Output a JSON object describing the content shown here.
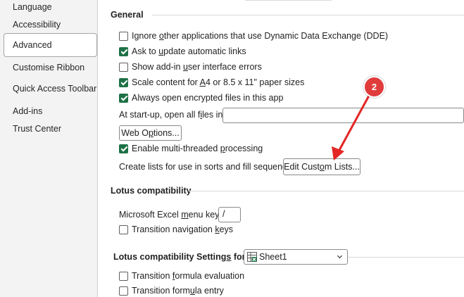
{
  "sidebar": {
    "items": [
      {
        "id": "language",
        "label": "Language"
      },
      {
        "id": "accessibility",
        "label": "Accessibility"
      },
      {
        "id": "advanced",
        "label": "Advanced",
        "selected": true
      },
      {
        "id": "customise-ribbon",
        "label": "Customise Ribbon"
      },
      {
        "id": "quick-access-toolbar",
        "label": "Quick Access Toolbar"
      },
      {
        "id": "add-ins",
        "label": "Add-ins"
      },
      {
        "id": "trust-center",
        "label": "Trust Center"
      }
    ]
  },
  "general": {
    "title": "General",
    "ignore_dde": {
      "pre": "Ignore ",
      "key": "o",
      "post": "ther applications that use Dynamic Data Exchange (DDE)",
      "checked": false
    },
    "update_links": {
      "pre": "Ask to ",
      "key": "u",
      "post": "pdate automatic links",
      "checked": true
    },
    "addin_errors": {
      "pre": "Show add-in ",
      "key": "u",
      "post": "ser interface errors",
      "checked": false
    },
    "scale_content": {
      "pre": "Scale content for ",
      "key": "A",
      "post": "4 or 8.5 x 11\" paper sizes",
      "checked": true
    },
    "encrypted_files": {
      "label": "Always open encrypted files in this app",
      "checked": true
    },
    "startup_label": {
      "pre": "At start-up, open all f",
      "key": "i",
      "post": "les in:"
    },
    "startup_value": "",
    "web_options": {
      "pre": "Web O",
      "key": "p",
      "post": "tions..."
    },
    "multithreaded": {
      "pre": "Enable multi-threaded ",
      "key": "p",
      "post": "rocessing",
      "checked": true
    },
    "custom_lists_label": "Create lists for use in sorts and fill sequences:",
    "edit_custom_lists": {
      "pre": "Edit Cust",
      "key": "o",
      "post": "m Lists..."
    }
  },
  "lotus": {
    "title": "Lotus compatibility",
    "menu_key_label": {
      "pre": "Microsoft Excel ",
      "key": "m",
      "post": "enu key:"
    },
    "menu_key_value": "/",
    "transition_nav": {
      "pre": "Transition navigation ",
      "key": "k",
      "post": "eys",
      "checked": false
    }
  },
  "lotus_settings": {
    "title": {
      "pre": "Lotus compatibility Setting",
      "key": "s",
      "post": " for:"
    },
    "sheet": "Sheet1",
    "formula_eval": {
      "pre": "Transition ",
      "key": "f",
      "post": "ormula evaluation",
      "checked": false
    },
    "formula_entry": {
      "pre": "Transition form",
      "key": "u",
      "post": "la entry",
      "checked": false
    }
  },
  "annotation": {
    "number": "2"
  },
  "colors": {
    "accent": "#1e7145",
    "badge": "#e03c3c",
    "arrow": "#e32626"
  }
}
